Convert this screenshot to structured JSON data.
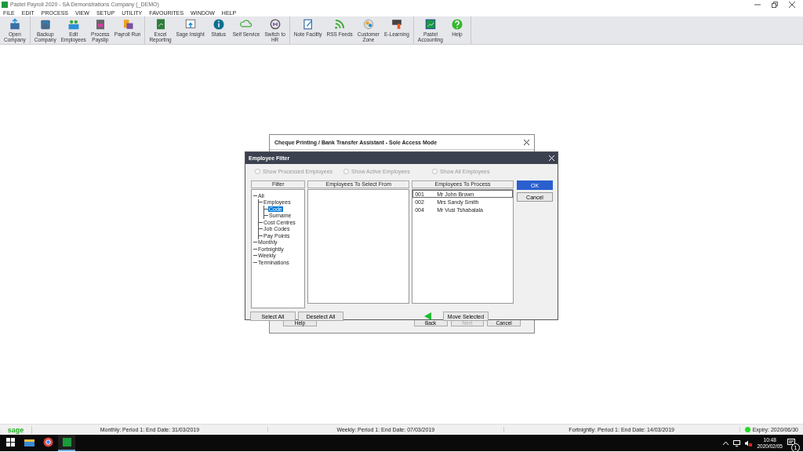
{
  "window": {
    "title": "Pastel Payroll 2020 - SA Demonstrations Company (_DEMO)"
  },
  "menu": [
    "FILE",
    "EDIT",
    "PROCESS",
    "VIEW",
    "SETUP",
    "UTILITY",
    "FAVOURITES",
    "WINDOW",
    "HELP"
  ],
  "toolbar_groups": [
    [
      "Open\nCompany"
    ],
    [
      "Backup\nCompany",
      "Edit\nEmployees",
      "Process\nPayslip",
      "Payroll Run"
    ],
    [
      "Excel\nReporting",
      "Sage Insight",
      "Status",
      "Self Service",
      "Switch to\nHR"
    ],
    [
      "Note Facility",
      "RSS Feeds",
      "Customer\nZone",
      "E-Learning"
    ],
    [
      "Pastel\nAccounting",
      "Help"
    ]
  ],
  "back_dialog": {
    "title": "Cheque Printing / Bank Transfer Assistant - Sole Access Mode",
    "buttons": [
      {
        "label": "Help",
        "disabled": false
      },
      {
        "label": "Back",
        "disabled": false
      },
      {
        "label": "Next",
        "disabled": true
      },
      {
        "label": "Cancel",
        "disabled": false
      }
    ]
  },
  "filter_dialog": {
    "title": "Employee Filter",
    "radios": [
      {
        "label": "Show Processed Employees",
        "checked": false,
        "disabled": true
      },
      {
        "label": "Show Active Employees",
        "checked": false,
        "disabled": true
      },
      {
        "label": "Show All Employees",
        "checked": false,
        "disabled": true
      }
    ],
    "filter": {
      "heading": "Filter",
      "tree": [
        {
          "label": "All",
          "selected": false,
          "children": [
            {
              "label": "Employees",
              "selected": false,
              "children": [
                {
                  "label": "Code",
                  "selected": true
                },
                {
                  "label": "Surname",
                  "selected": false
                }
              ]
            },
            {
              "label": "Cost Centres",
              "selected": false
            },
            {
              "label": "Job Codes",
              "selected": false
            },
            {
              "label": "Pay Points",
              "selected": false
            }
          ]
        },
        {
          "label": "Monthly",
          "selected": false
        },
        {
          "label": "Fortnightly",
          "selected": false
        },
        {
          "label": "Weekly",
          "selected": false
        },
        {
          "label": "Terminations",
          "selected": false
        }
      ]
    },
    "select_from": {
      "heading": "Employees To Select From"
    },
    "to_process": {
      "heading": "Employees To Process",
      "rows": [
        {
          "code": "001",
          "name": "Mr John Brown",
          "selected": true
        },
        {
          "code": "002",
          "name": "Mrs Sandy Smith",
          "selected": false
        },
        {
          "code": "004",
          "name": "Mr Vusi Tshabalala",
          "selected": false
        }
      ]
    },
    "ok": "OK",
    "cancel": "Cancel",
    "select_all": "Select All",
    "deselect_all": "Deselect All",
    "move_selected": "Move Selected"
  },
  "status_bar": {
    "logo": "sage",
    "periods": [
      "Monthly: Period 1: End Date: 31/03/2019",
      "Weekly: Period 1: End Date: 07/03/2019",
      "Fortnightly: Period 1: End Date: 14/03/2019"
    ],
    "expiry": "Expiry: 2020/06/30"
  },
  "taskbar": {
    "apps": [
      {
        "active": false
      },
      {
        "active": false
      },
      {
        "active": false
      },
      {
        "active": true
      }
    ],
    "time": "10:48",
    "date": "2020/02/05",
    "notifications": "1"
  }
}
